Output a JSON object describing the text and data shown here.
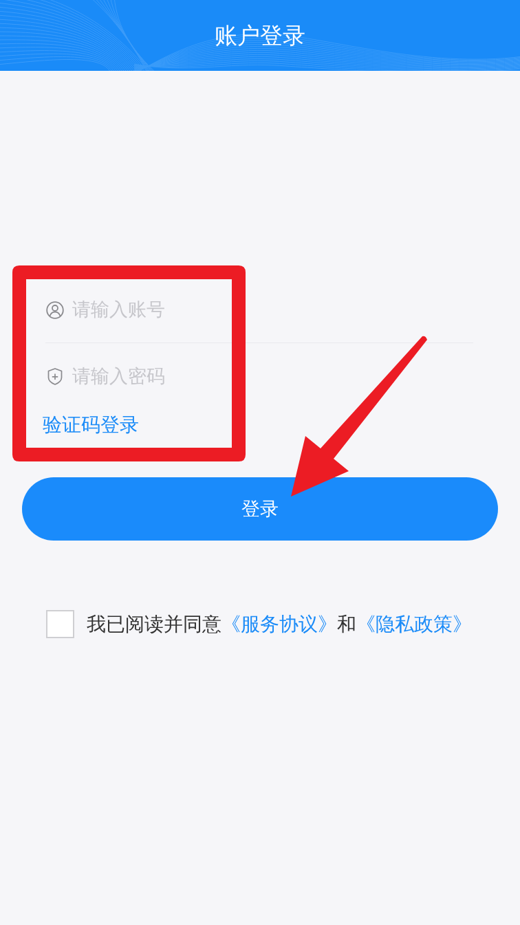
{
  "header": {
    "title": "账户登录"
  },
  "form": {
    "fields": [
      {
        "kind": "account",
        "placeholder": "请输入账号"
      },
      {
        "kind": "password",
        "placeholder": "请输入密码"
      }
    ],
    "alt_login_link": "验证码登录",
    "submit_button": "登录"
  },
  "agreement": {
    "checked": false,
    "parts": [
      {
        "kind": "text",
        "text": "我已阅读并同意"
      },
      {
        "kind": "link",
        "text": "《服务协议》"
      },
      {
        "kind": "text",
        "text": "和"
      },
      {
        "kind": "link",
        "text": "《隐私政策》"
      }
    ]
  },
  "annotations": {
    "highlight_frame": true,
    "arrow": true
  }
}
